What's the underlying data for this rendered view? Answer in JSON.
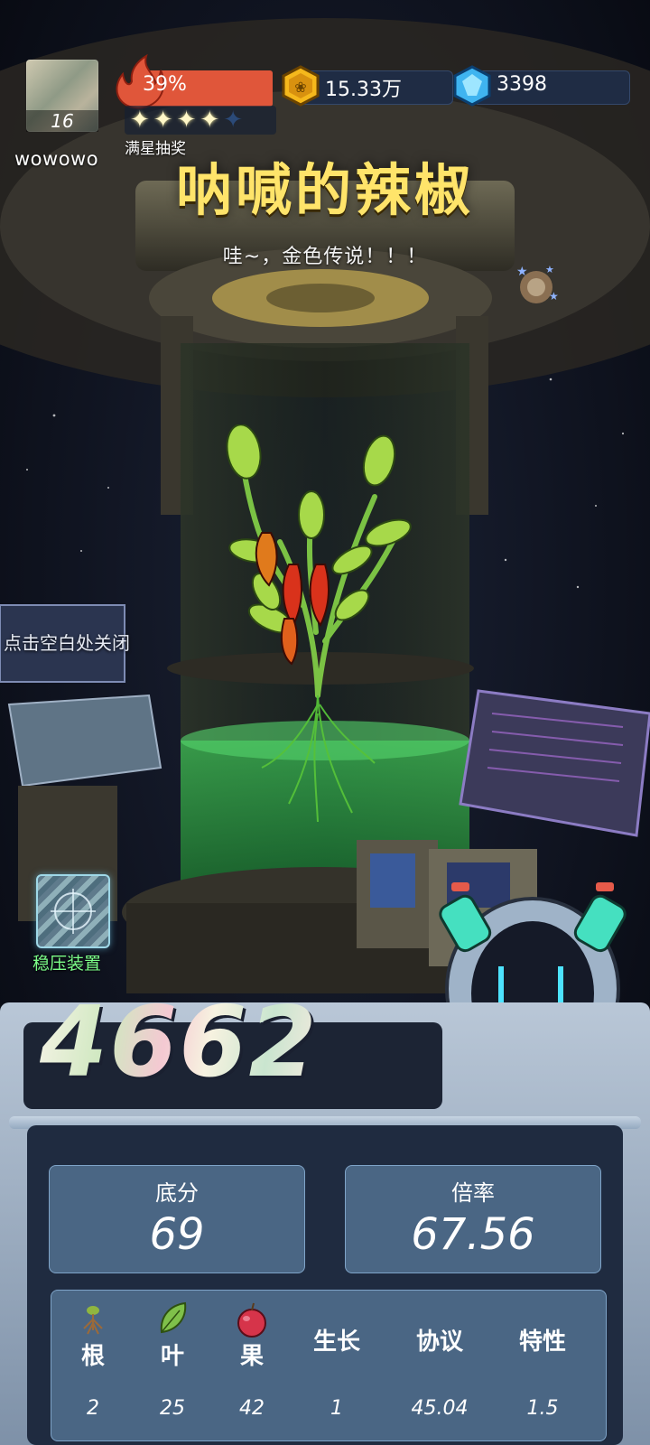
{
  "profile": {
    "level": "16",
    "username": "wowowo"
  },
  "heat": {
    "percent_label": "39%",
    "percent": 0.39
  },
  "stars": {
    "filled": 4,
    "total": 5,
    "label": "满星抽奖"
  },
  "currency": {
    "coins": "15.33万",
    "gems": "3398"
  },
  "result": {
    "plant_name": "呐喊的辣椒",
    "rarity_message": "哇~，金色传说！！！"
  },
  "hint": {
    "close": "点击空白处关闭"
  },
  "stabilizer": {
    "label": "稳压装置"
  },
  "score": {
    "total": "4662"
  },
  "stats": {
    "base": {
      "label": "底分",
      "value": "69"
    },
    "multiplier": {
      "label": "倍率",
      "value": "67.56"
    }
  },
  "details": {
    "columns": [
      {
        "label": "根",
        "value": "2",
        "icon": "root-icon"
      },
      {
        "label": "叶",
        "value": "25",
        "icon": "leaf-icon"
      },
      {
        "label": "果",
        "value": "42",
        "icon": "fruit-icon"
      },
      {
        "label": "生长",
        "value": "1"
      },
      {
        "label": "协议",
        "value": "45.04"
      },
      {
        "label": "特性",
        "value": "1.5"
      }
    ]
  },
  "colors": {
    "title": "#ffe46a",
    "heat": "#e0563a",
    "accent_green": "#7dff8a",
    "panel": "#4a6684"
  }
}
